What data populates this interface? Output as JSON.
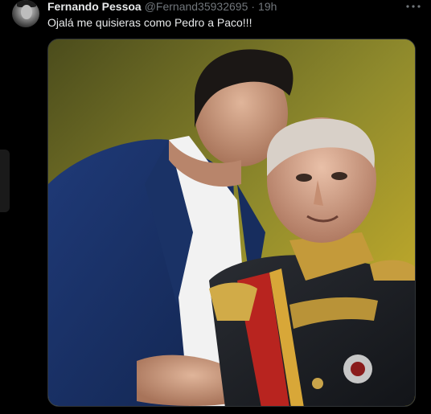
{
  "tweet": {
    "display_name": "Fernando Pessoa",
    "handle": "@Fernand35932695",
    "separator": "·",
    "time": "19h",
    "text": "Ojalá me quisieras como Pedro a Paco!!!"
  },
  "icons": {
    "avatar": "profile-avatar",
    "more": "more-options-icon"
  },
  "colors": {
    "background": "#000000",
    "primary_text": "#e7e9ea",
    "secondary_text": "#71767b",
    "border": "#2f3336"
  }
}
